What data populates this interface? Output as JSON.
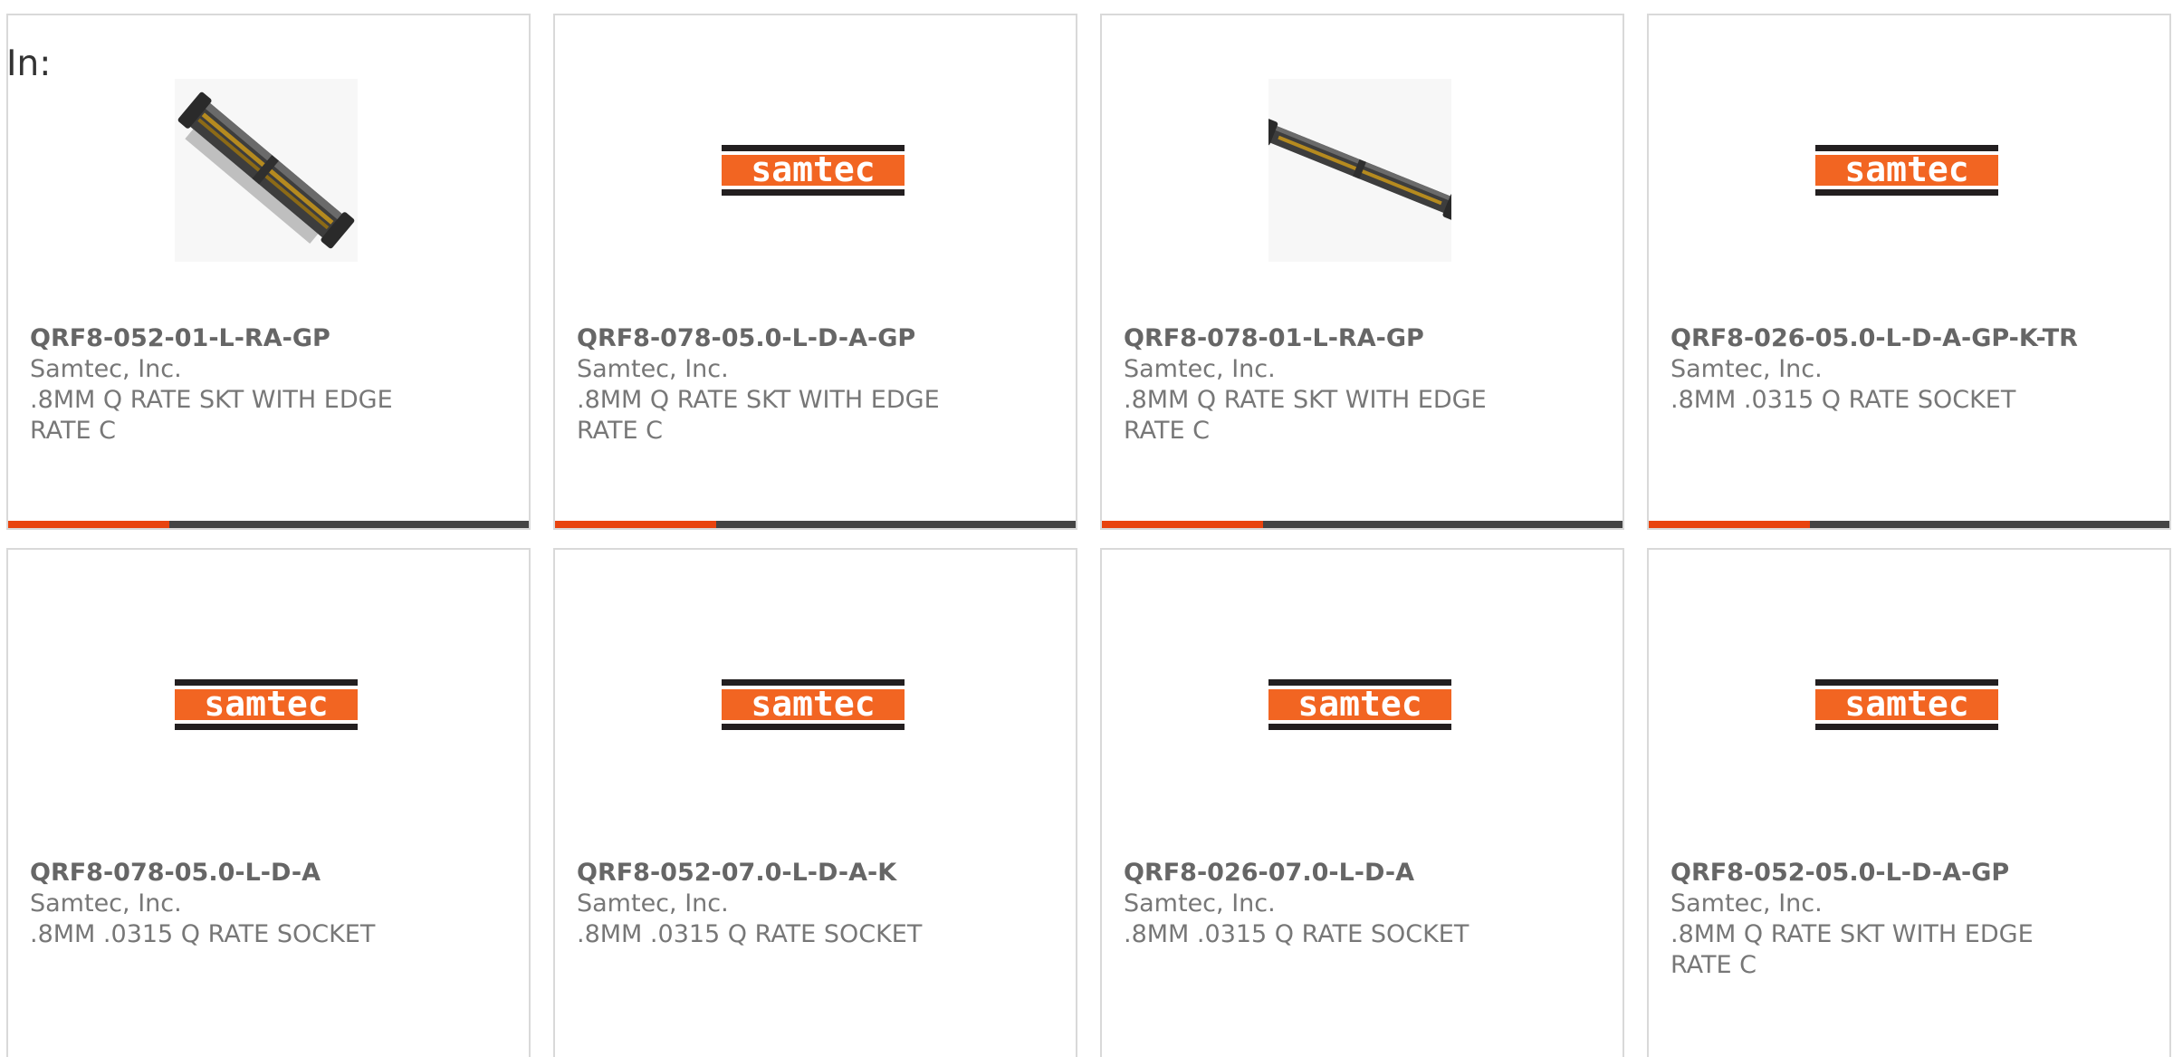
{
  "filter": {
    "label": "In:"
  },
  "colors": {
    "accent": "#e8440f",
    "bar": "#444444",
    "logo_orange": "#f26522",
    "logo_dark": "#231f20"
  },
  "cards": [
    {
      "part_number": "QRF8-052-01-L-RA-GP",
      "manufacturer": "Samtec, Inc.",
      "description": ".8MM Q RATE SKT WITH EDGE RATE C",
      "image": "connector-photo-angled",
      "accent_fill": 0.31
    },
    {
      "part_number": "QRF8-078-05.0-L-D-A-GP",
      "manufacturer": "Samtec, Inc.",
      "description": ".8MM Q RATE SKT WITH EDGE RATE C",
      "image": "samtec-logo",
      "logo_text": "samtec",
      "accent_fill": 0.31
    },
    {
      "part_number": "QRF8-078-01-L-RA-GP",
      "manufacturer": "Samtec, Inc.",
      "description": ".8MM Q RATE SKT WITH EDGE RATE C",
      "image": "connector-photo-flat",
      "accent_fill": 0.31
    },
    {
      "part_number": "QRF8-026-05.0-L-D-A-GP-K-TR",
      "manufacturer": "Samtec, Inc.",
      "description": ".8MM .0315 Q RATE SOCKET",
      "image": "samtec-logo",
      "logo_text": "samtec",
      "accent_fill": 0.31
    },
    {
      "part_number": "QRF8-078-05.0-L-D-A",
      "manufacturer": "Samtec, Inc.",
      "description": ".8MM .0315 Q RATE SOCKET",
      "image": "samtec-logo",
      "logo_text": "samtec"
    },
    {
      "part_number": "QRF8-052-07.0-L-D-A-K",
      "manufacturer": "Samtec, Inc.",
      "description": ".8MM .0315 Q RATE SOCKET",
      "image": "samtec-logo",
      "logo_text": "samtec"
    },
    {
      "part_number": "QRF8-026-07.0-L-D-A",
      "manufacturer": "Samtec, Inc.",
      "description": ".8MM .0315 Q RATE SOCKET",
      "image": "samtec-logo",
      "logo_text": "samtec"
    },
    {
      "part_number": "QRF8-052-05.0-L-D-A-GP",
      "manufacturer": "Samtec, Inc.",
      "description": ".8MM Q RATE SKT WITH EDGE RATE C",
      "image": "samtec-logo",
      "logo_text": "samtec"
    }
  ]
}
